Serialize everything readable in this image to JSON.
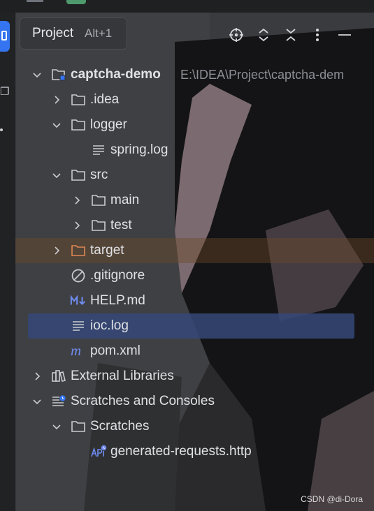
{
  "header": {
    "tab_label": "Project",
    "tab_shortcut": "Alt+1",
    "icons": [
      "crosshair-icon",
      "expand-all-icon",
      "collapse-all-icon",
      "more-icon",
      "minimize-icon"
    ]
  },
  "tree": {
    "root": {
      "label": "captcha-demo",
      "path": "E:\\IDEA\\Project\\captcha-dem"
    },
    "idea": "idea",
    "logger": "logger",
    "spring_log": "spring.log",
    "src": "src",
    "main": "main",
    "test": "test",
    "target": "target",
    "gitignore": ".gitignore",
    "help_md": "HELP.md",
    "ioc_log": "ioc.log",
    "pom_xml": "pom.xml",
    "external_libraries": "External Libraries",
    "scratches_and_consoles": "Scratches and Consoles",
    "scratches": "Scratches",
    "generated_requests": "generated-requests.http"
  },
  "watermark": "CSDN @di-Dora",
  "colors": {
    "accent": "#3574f0",
    "selection": "#354878",
    "excluded_folder": "#e08855",
    "maven": "#6f8cf0"
  }
}
